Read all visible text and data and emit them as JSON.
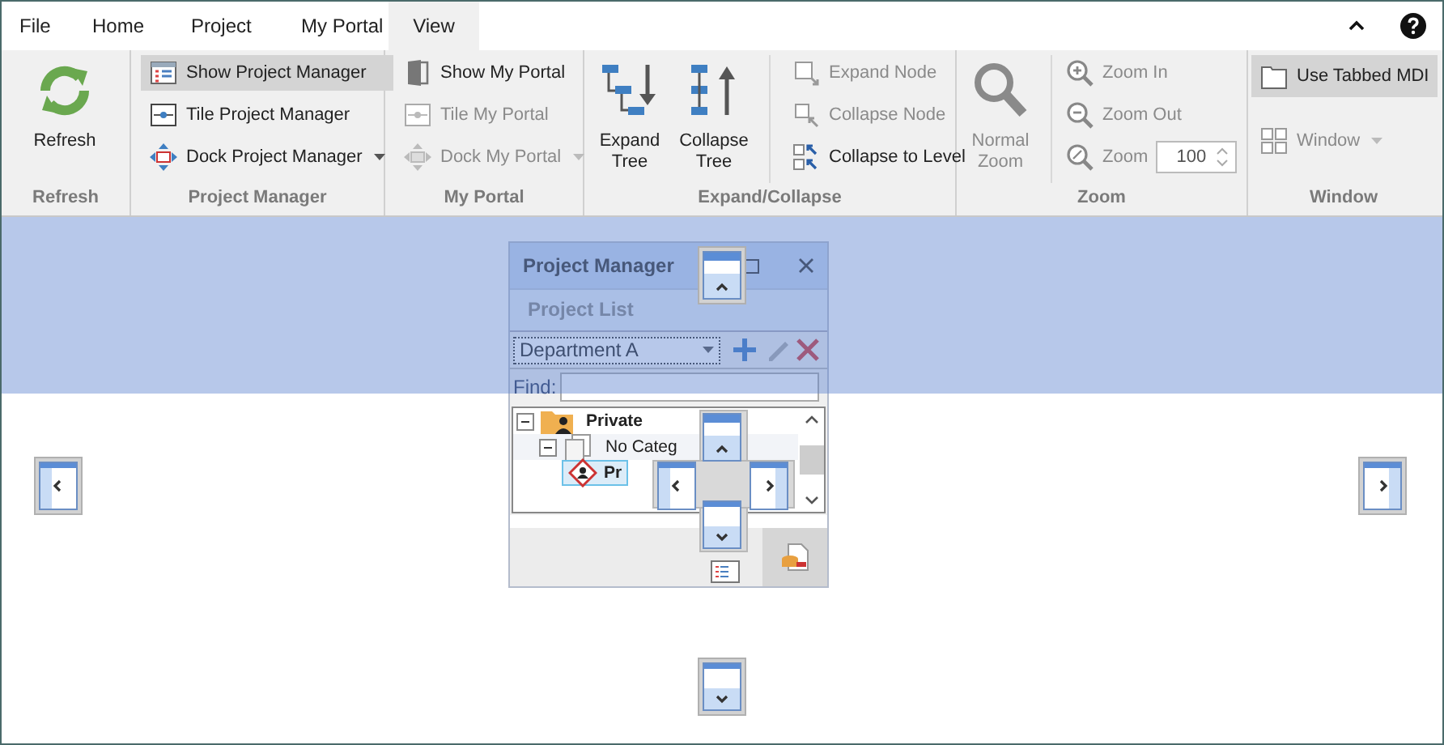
{
  "tabs": [
    {
      "label": "File",
      "selected": false
    },
    {
      "label": "Home",
      "selected": false
    },
    {
      "label": "Project",
      "selected": false
    },
    {
      "label": "My Portal",
      "selected": false
    },
    {
      "label": "View",
      "selected": true
    }
  ],
  "ribbon_groups": [
    {
      "title": "Refresh",
      "columns": [
        {
          "kind": "large",
          "items": [
            {
              "lines": [
                "Refresh"
              ],
              "disabled": false
            }
          ]
        }
      ]
    },
    {
      "title": "Project Manager",
      "columns": [
        {
          "kind": "stack",
          "items": [
            {
              "label": "Show Project Manager",
              "kind": "button",
              "disabled": false,
              "selected": true
            },
            {
              "label": "Tile Project Manager",
              "kind": "button",
              "disabled": false,
              "selected": false
            },
            {
              "label": "Dock Project Manager",
              "kind": "dropdown",
              "disabled": false,
              "selected": false
            }
          ]
        }
      ]
    },
    {
      "title": "My Portal",
      "columns": [
        {
          "kind": "stack",
          "items": [
            {
              "label": "Show My Portal",
              "kind": "button",
              "disabled": false,
              "selected": false
            },
            {
              "label": "Tile My Portal",
              "kind": "button",
              "disabled": true,
              "selected": false
            },
            {
              "label": "Dock My Portal",
              "kind": "dropdown",
              "disabled": true,
              "selected": false
            }
          ]
        }
      ]
    },
    {
      "title": "Expand/Collapse",
      "columns": [
        {
          "kind": "large",
          "items": [
            {
              "lines": [
                "Expand",
                "Tree"
              ],
              "disabled": false
            },
            {
              "lines": [
                "Collapse",
                "Tree"
              ],
              "disabled": false
            }
          ]
        },
        {
          "kind": "stack",
          "items": [
            {
              "label": "Expand Node",
              "kind": "button",
              "disabled": true,
              "selected": false
            },
            {
              "label": "Collapse Node",
              "kind": "button",
              "disabled": true,
              "selected": false
            },
            {
              "label": "Collapse to Level",
              "kind": "button",
              "disabled": false,
              "selected": false
            }
          ]
        }
      ]
    },
    {
      "title": "Zoom",
      "columns": [
        {
          "kind": "large",
          "items": [
            {
              "lines": [
                "Normal",
                "Zoom"
              ],
              "disabled": true
            }
          ]
        },
        {
          "kind": "stack",
          "items": [
            {
              "label": "Zoom In",
              "kind": "button",
              "disabled": true,
              "selected": false
            },
            {
              "label": "Zoom Out",
              "kind": "button",
              "disabled": true,
              "selected": false
            },
            {
              "label": "Zoom",
              "kind": "spin",
              "value": "100",
              "disabled": true,
              "selected": false
            }
          ]
        }
      ]
    },
    {
      "title": "Window",
      "columns": [
        {
          "kind": "stack",
          "items": [
            {
              "label": "Use Tabbed MDI",
              "kind": "button",
              "disabled": false,
              "selected": true
            },
            {
              "label": "Window",
              "kind": "dropdown",
              "disabled": true,
              "selected": false
            }
          ]
        }
      ]
    }
  ],
  "project_manager": {
    "title": "Project Manager",
    "tab": "Project List",
    "department": "Department A",
    "find_label": "Find:",
    "tree": [
      {
        "label": "Private",
        "selected": false,
        "expanded": true,
        "children": [
          {
            "label": "No Categ",
            "selected": false,
            "expanded": true,
            "children": [
              {
                "label": "Pr",
                "selected": true
              }
            ]
          }
        ]
      }
    ]
  }
}
